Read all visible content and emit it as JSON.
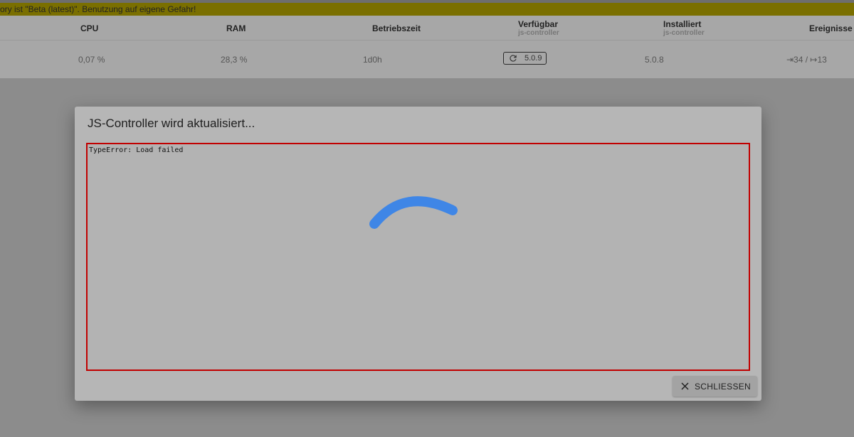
{
  "warning": {
    "text": "ory ist \"Beta (latest)\". Benutzung auf eigene Gefahr!"
  },
  "table": {
    "headers": {
      "cpu": "CPU",
      "ram": "RAM",
      "uptime": "Betriebszeit",
      "available": "Verfügbar",
      "available_sub": "js-controller",
      "installed": "Installiert",
      "installed_sub": "js-controller",
      "events": "Ereignisse"
    },
    "row": {
      "cpu": "0,07 %",
      "ram": "28,3 %",
      "uptime": "1d0h",
      "available_version": "5.0.9",
      "installed_version": "5.0.8",
      "events": "⇥34 / ↦13"
    }
  },
  "dialog": {
    "title": "JS-Controller wird aktualisiert...",
    "log_line": "TypeError: Load failed",
    "close_label": "SCHLIESSEN"
  },
  "colors": {
    "spinner": "#3f86e6",
    "log_border": "#c10000"
  },
  "icons": {
    "refresh": "refresh-icon",
    "close": "close-icon"
  }
}
